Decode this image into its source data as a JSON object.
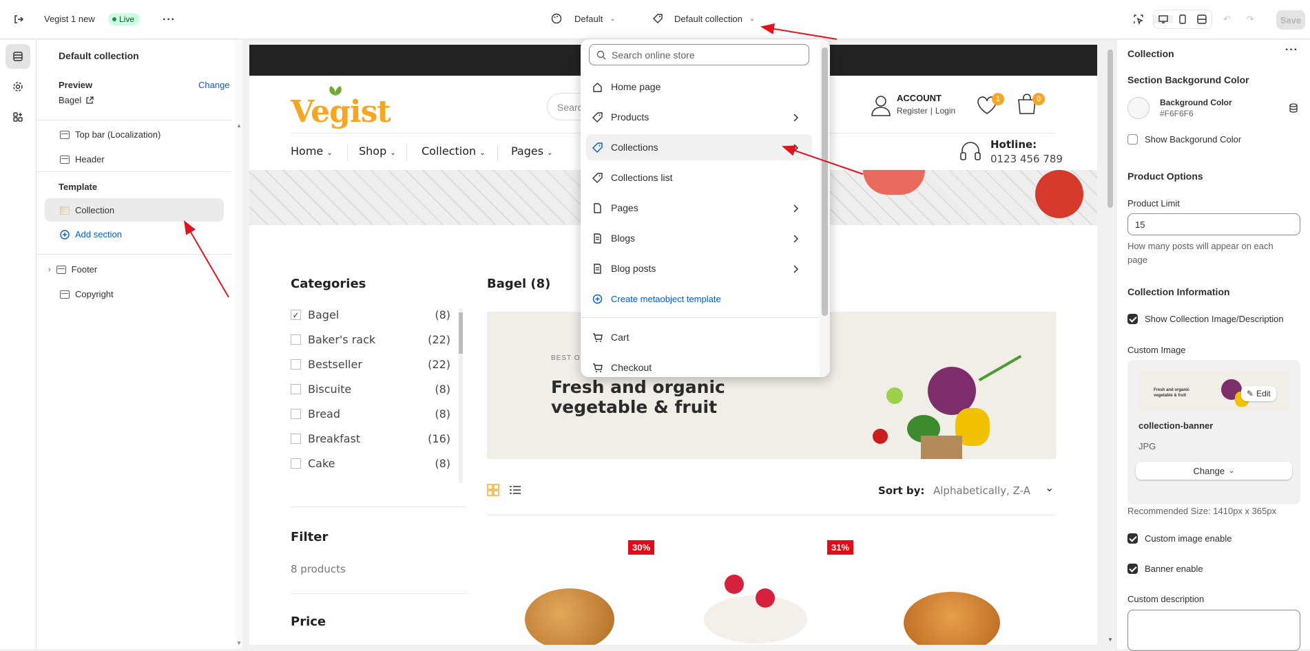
{
  "topbar": {
    "store_name": "Vegist 1 new",
    "live_label": "Live",
    "theme_select": "Default",
    "template_select": "Default collection",
    "save_label": "Save"
  },
  "sidebar": {
    "title": "Default collection",
    "preview_label": "Preview",
    "change_label": "Change",
    "preview_value": "Bagel",
    "header_sections": [
      "Top bar (Localization)",
      "Header"
    ],
    "template_heading": "Template",
    "template_item": "Collection",
    "add_section": "Add section",
    "footer_sections": [
      "Footer",
      "Copyright"
    ]
  },
  "dropdown": {
    "search_placeholder": "Search online store",
    "items": [
      {
        "label": "Home page",
        "icon": "home-icon",
        "chevron": false
      },
      {
        "label": "Products",
        "icon": "tag-icon",
        "chevron": true
      },
      {
        "label": "Collections",
        "icon": "collection-tag-icon",
        "chevron": true
      },
      {
        "label": "Collections list",
        "icon": "tag-icon",
        "chevron": false
      },
      {
        "label": "Pages",
        "icon": "page-icon",
        "chevron": true
      },
      {
        "label": "Blogs",
        "icon": "blog-icon",
        "chevron": true
      },
      {
        "label": "Blog posts",
        "icon": "blog-icon",
        "chevron": true
      },
      {
        "label": "Create metaobject template",
        "icon": "plus-circle-icon",
        "chevron": false
      },
      {
        "label": "Cart",
        "icon": "cart-icon",
        "chevron": false
      },
      {
        "label": "Checkout",
        "icon": "cart-icon",
        "chevron": false
      }
    ]
  },
  "store": {
    "logo": "Vegist",
    "search_placeholder": "Searc",
    "account_label": "ACCOUNT",
    "register_label": "Register",
    "login_label": "Login",
    "wishlist_count": "1",
    "cart_count": "0",
    "menu": [
      "Home",
      "Shop",
      "Collection",
      "Pages"
    ],
    "hotline_label": "Hotline:",
    "hotline_number": "0123 456 789",
    "categories_heading": "Categories",
    "categories": [
      {
        "name": "Bagel",
        "count": "(8)",
        "checked": true
      },
      {
        "name": "Baker's rack",
        "count": "(22)",
        "checked": false
      },
      {
        "name": "Bestseller",
        "count": "(22)",
        "checked": false
      },
      {
        "name": "Biscuite",
        "count": "(8)",
        "checked": false
      },
      {
        "name": "Bread",
        "count": "(8)",
        "checked": false
      },
      {
        "name": "Breakfast",
        "count": "(16)",
        "checked": false
      },
      {
        "name": "Cake",
        "count": "(8)",
        "checked": false
      }
    ],
    "filter_heading": "Filter",
    "filter_count": "8 products",
    "price_heading": "Price",
    "collection_title": "Bagel (8)",
    "banner_small": "BEST OR",
    "banner_line1": "Fresh and organic",
    "banner_line2": "vegetable & fruit",
    "sort_label": "Sort by:",
    "sort_value": "Alphabetically, Z-A",
    "badges": [
      "30%",
      "31%"
    ]
  },
  "rpanel": {
    "title": "Collection",
    "section_bg_heading": "Section Backgorund Color",
    "bg_color_label": "Background Color",
    "bg_color_value": "#F6F6F6",
    "show_bg_label": "Show Backgorund Color",
    "product_options_heading": "Product Options",
    "product_limit_label": "Product Limit",
    "product_limit_value": "15",
    "product_limit_help": "How many posts will appear on each page",
    "collection_info_heading": "Collection Information",
    "show_collection_label": "Show Collection Image/Description",
    "custom_image_label": "Custom Image",
    "edit_label": "Edit",
    "image_name": "collection-banner",
    "image_type": "JPG",
    "change_label": "Change",
    "recommended": "Recommended Size: 1410px x 365px",
    "custom_image_enable": "Custom image enable",
    "banner_enable": "Banner enable",
    "custom_description": "Custom description"
  },
  "colors": {
    "accent": "#005bd3",
    "sale_badge": "#e30b17",
    "logo_orange": "#f5a623",
    "logo_green": "#6ca92f",
    "live_bg": "#cdfee1",
    "arrow_red": "#e0141e"
  }
}
